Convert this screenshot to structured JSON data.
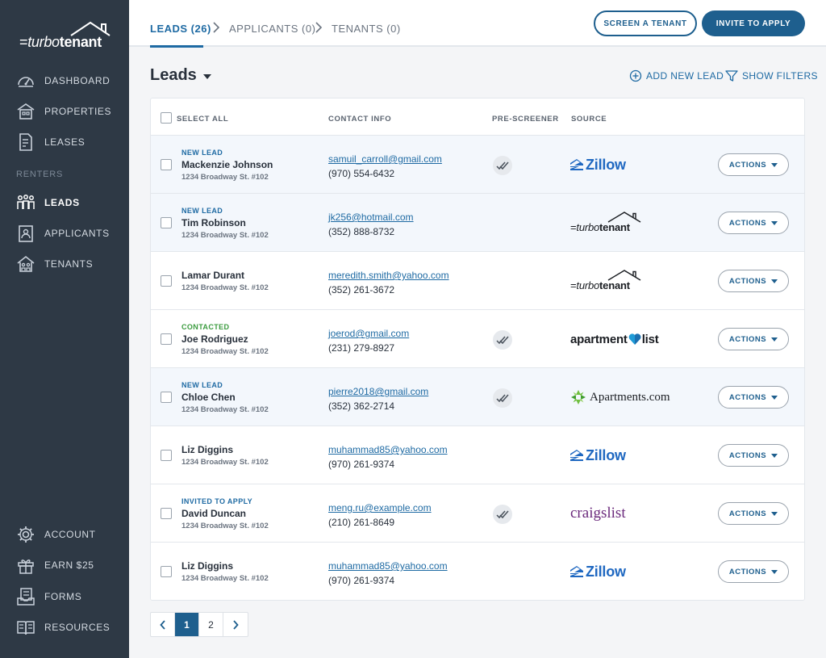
{
  "brand": {
    "wordmark_prefix": "turbo",
    "wordmark_suffix": "tenant"
  },
  "sidebar": {
    "top_items": [
      {
        "label": "DASHBOARD",
        "icon": "gauge-icon"
      },
      {
        "label": "PROPERTIES",
        "icon": "building-icon"
      },
      {
        "label": "LEASES",
        "icon": "document-edit-icon"
      }
    ],
    "section_label": "RENTERS",
    "renter_items": [
      {
        "label": "LEADS",
        "icon": "people-icon",
        "active": true
      },
      {
        "label": "APPLICANTS",
        "icon": "applicant-icon"
      },
      {
        "label": "TENANTS",
        "icon": "tenant-house-icon"
      }
    ],
    "bottom_items": [
      {
        "label": "ACCOUNT",
        "icon": "gear-icon"
      },
      {
        "label": "EARN $25",
        "icon": "gift-icon"
      },
      {
        "label": "FORMS",
        "icon": "forms-icon"
      },
      {
        "label": "RESOURCES",
        "icon": "book-icon"
      }
    ]
  },
  "breadcrumb": {
    "leads": "LEADS (26)",
    "applicants": "APPLICANTS (0)",
    "tenants": "TENANTS (0)"
  },
  "top_buttons": {
    "screen": "SCREEN A TENANT",
    "invite": "INVITE TO APPLY"
  },
  "content": {
    "title": "Leads",
    "add_lead": "ADD NEW LEAD",
    "show_filters": "SHOW FILTERS"
  },
  "table": {
    "headers": {
      "select_all": "SELECT ALL",
      "contact": "CONTACT INFO",
      "prescreener": "PRE-SCREENER",
      "source": "SOURCE"
    },
    "actions_label": "ACTIONS",
    "rows": [
      {
        "status": "NEW LEAD",
        "name": "Mackenzie Johnson",
        "address": "1234 Broadway St. #102",
        "email": "samuil_carroll@gmail.com",
        "phone": "(970) 554-6432",
        "prescreened": true,
        "source": "zillow",
        "highlight": true
      },
      {
        "status": "NEW LEAD",
        "name": "Tim Robinson",
        "address": "1234 Broadway St. #102",
        "email": "jk256@hotmail.com",
        "phone": "(352) 888-8732",
        "prescreened": false,
        "source": "turbotenant",
        "highlight": true
      },
      {
        "status": "",
        "name": "Lamar Durant",
        "address": "1234 Broadway St. #102",
        "email": "meredith.smith@yahoo.com",
        "phone": "(352) 261-3672",
        "prescreened": false,
        "source": "turbotenant",
        "highlight": false
      },
      {
        "status": "CONTACTED",
        "name": "Joe Rodriguez",
        "address": "1234 Broadway St. #102",
        "email": "joerod@gmail.com",
        "phone": "(231) 279-8927",
        "prescreened": true,
        "source": "apartmentlist",
        "highlight": false
      },
      {
        "status": "NEW LEAD",
        "name": "Chloe Chen",
        "address": "1234 Broadway St. #102",
        "email": "pierre2018@gmail.com",
        "phone": "(352) 362-2714",
        "prescreened": true,
        "source": "apartments",
        "highlight": true
      },
      {
        "status": "",
        "name": "Liz Diggins",
        "address": "1234 Broadway St. #102",
        "email": "muhammad85@yahoo.com",
        "phone": "(970) 261-9374",
        "prescreened": false,
        "source": "zillow",
        "highlight": false
      },
      {
        "status": "INVITED TO APPLY",
        "name": "David Duncan",
        "address": "1234 Broadway St. #102",
        "email": "meng.ru@example.com",
        "phone": "(210) 261-8649",
        "prescreened": true,
        "source": "craigslist",
        "highlight": false
      },
      {
        "status": "",
        "name": "Liz Diggins",
        "address": "1234 Broadway St. #102",
        "email": "muhammad85@yahoo.com",
        "phone": "(970) 261-9374",
        "prescreened": false,
        "source": "zillow",
        "highlight": false
      }
    ]
  },
  "sources": {
    "zillow": "Zillow",
    "apartmentlist_a": "apartment",
    "apartmentlist_b": "list",
    "apartments": "Apartments.com",
    "craigslist": "craigslist"
  },
  "pagination": {
    "pages": [
      "1",
      "2"
    ],
    "current": "1"
  },
  "colors": {
    "sidebar": "#2e3945",
    "primary": "#1e5f8e",
    "link": "#1e6aa3",
    "zillow": "#1f68c1",
    "craigslist": "#6b2a7c",
    "contacted": "#3a9b3e"
  }
}
